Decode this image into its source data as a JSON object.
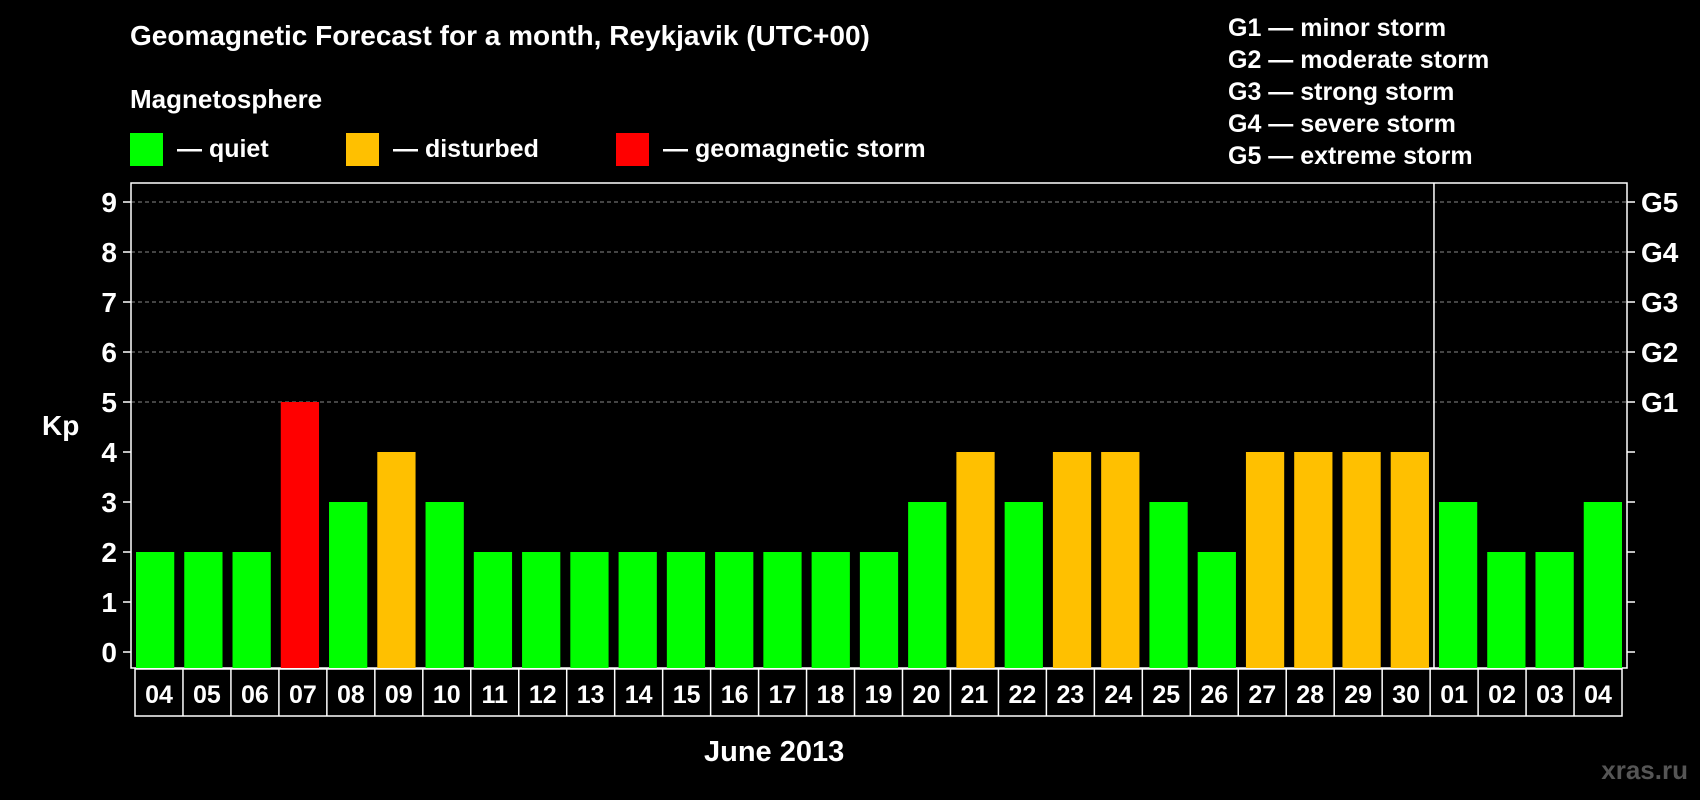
{
  "title": "Geomagnetic Forecast for a month, Reykjavik (UTC+00)",
  "subtitle": "Magnetosphere",
  "legend": [
    {
      "label": "— quiet",
      "color": "#00ff00"
    },
    {
      "label": "— disturbed",
      "color": "#ffc000"
    },
    {
      "label": "— geomagnetic storm",
      "color": "#ff0000"
    }
  ],
  "storm_levels": [
    "G1 — minor storm",
    "G2 — moderate storm",
    "G3 — strong storm",
    "G4 — severe storm",
    "G5 — extreme storm"
  ],
  "watermark": "xras.ru",
  "colors": {
    "background": "#000000",
    "quiet": "#00ff00",
    "disturbed": "#ffc000",
    "storm": "#ff0000",
    "grid": "#888888",
    "axis": "#ffffff"
  },
  "chart_data": {
    "type": "bar",
    "title": "Geomagnetic Forecast for a month, Reykjavik (UTC+00)",
    "xlabel": "June 2013",
    "ylabel": "Kp",
    "ylim": [
      0,
      9
    ],
    "yticks": [
      "0",
      "1",
      "2",
      "3",
      "4",
      "5",
      "6",
      "7",
      "8",
      "9"
    ],
    "right_ticks": [
      {
        "kp": 5,
        "label": "G1"
      },
      {
        "kp": 6,
        "label": "G2"
      },
      {
        "kp": 7,
        "label": "G3"
      },
      {
        "kp": 8,
        "label": "G4"
      },
      {
        "kp": 9,
        "label": "G5"
      }
    ],
    "dashed_grid_at": [
      5,
      6,
      7,
      8,
      9
    ],
    "month_divider_after": "30",
    "categories": [
      "04",
      "05",
      "06",
      "07",
      "08",
      "09",
      "10",
      "11",
      "12",
      "13",
      "14",
      "15",
      "16",
      "17",
      "18",
      "19",
      "20",
      "21",
      "22",
      "23",
      "24",
      "25",
      "26",
      "27",
      "28",
      "29",
      "30",
      "01",
      "02",
      "03",
      "04"
    ],
    "values": [
      2,
      2,
      2,
      5,
      3,
      4,
      3,
      2,
      2,
      2,
      2,
      2,
      2,
      2,
      2,
      2,
      3,
      4,
      3,
      4,
      4,
      3,
      2,
      4,
      4,
      4,
      4,
      3,
      2,
      2,
      3
    ],
    "status": [
      "quiet",
      "quiet",
      "quiet",
      "storm",
      "quiet",
      "disturbed",
      "quiet",
      "quiet",
      "quiet",
      "quiet",
      "quiet",
      "quiet",
      "quiet",
      "quiet",
      "quiet",
      "quiet",
      "quiet",
      "disturbed",
      "quiet",
      "disturbed",
      "disturbed",
      "quiet",
      "quiet",
      "disturbed",
      "disturbed",
      "disturbed",
      "disturbed",
      "quiet",
      "quiet",
      "quiet",
      "quiet"
    ]
  }
}
